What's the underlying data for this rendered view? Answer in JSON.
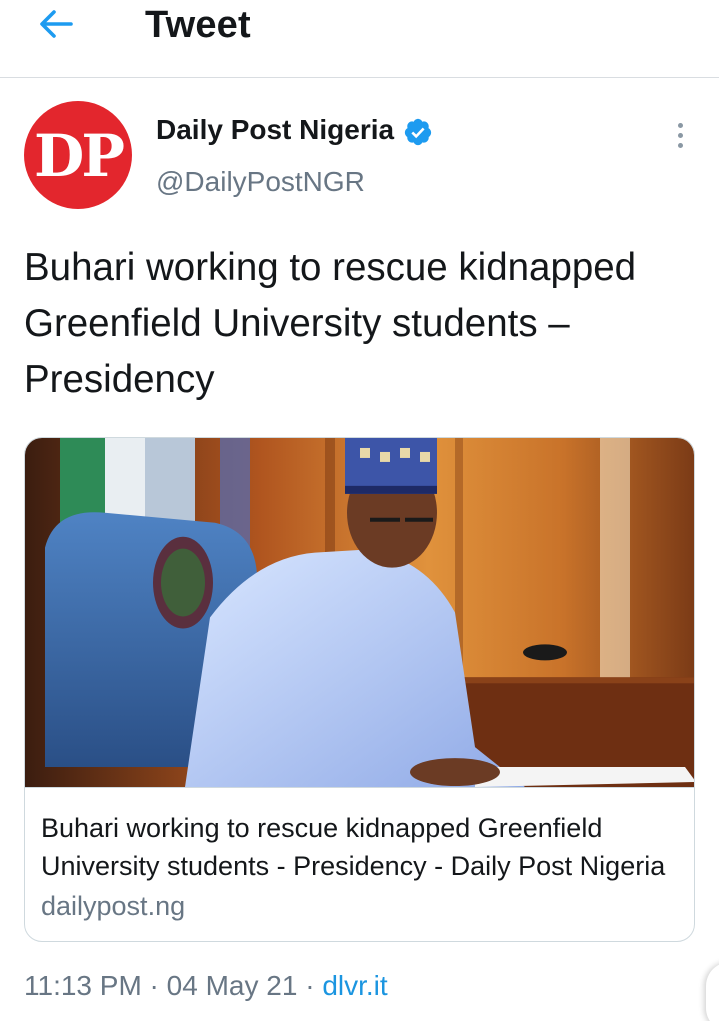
{
  "header": {
    "title": "Tweet"
  },
  "author": {
    "avatar_text": "DP",
    "display_name": "Daily Post Nigeria",
    "handle": "@DailyPostNGR",
    "verified": true
  },
  "tweet": {
    "text": "Buhari working to rescue kidnapped Greenfield University students – Presidency"
  },
  "card": {
    "title": "Buhari working to rescue kidnapped Greenfield University students - Presidency - Daily Post Nigeria",
    "domain": "dailypost.ng"
  },
  "meta": {
    "time": "11:13 PM",
    "date": "04 May 21",
    "source": "dlvr.it",
    "separator": " · "
  },
  "colors": {
    "accent": "#1d9bf0",
    "link": "#1b95e0",
    "avatar_bg": "#e3262d",
    "muted": "#687684"
  },
  "icons": {
    "back": "arrow-left-icon",
    "verified": "verified-badge-icon",
    "more": "more-vertical-icon"
  }
}
